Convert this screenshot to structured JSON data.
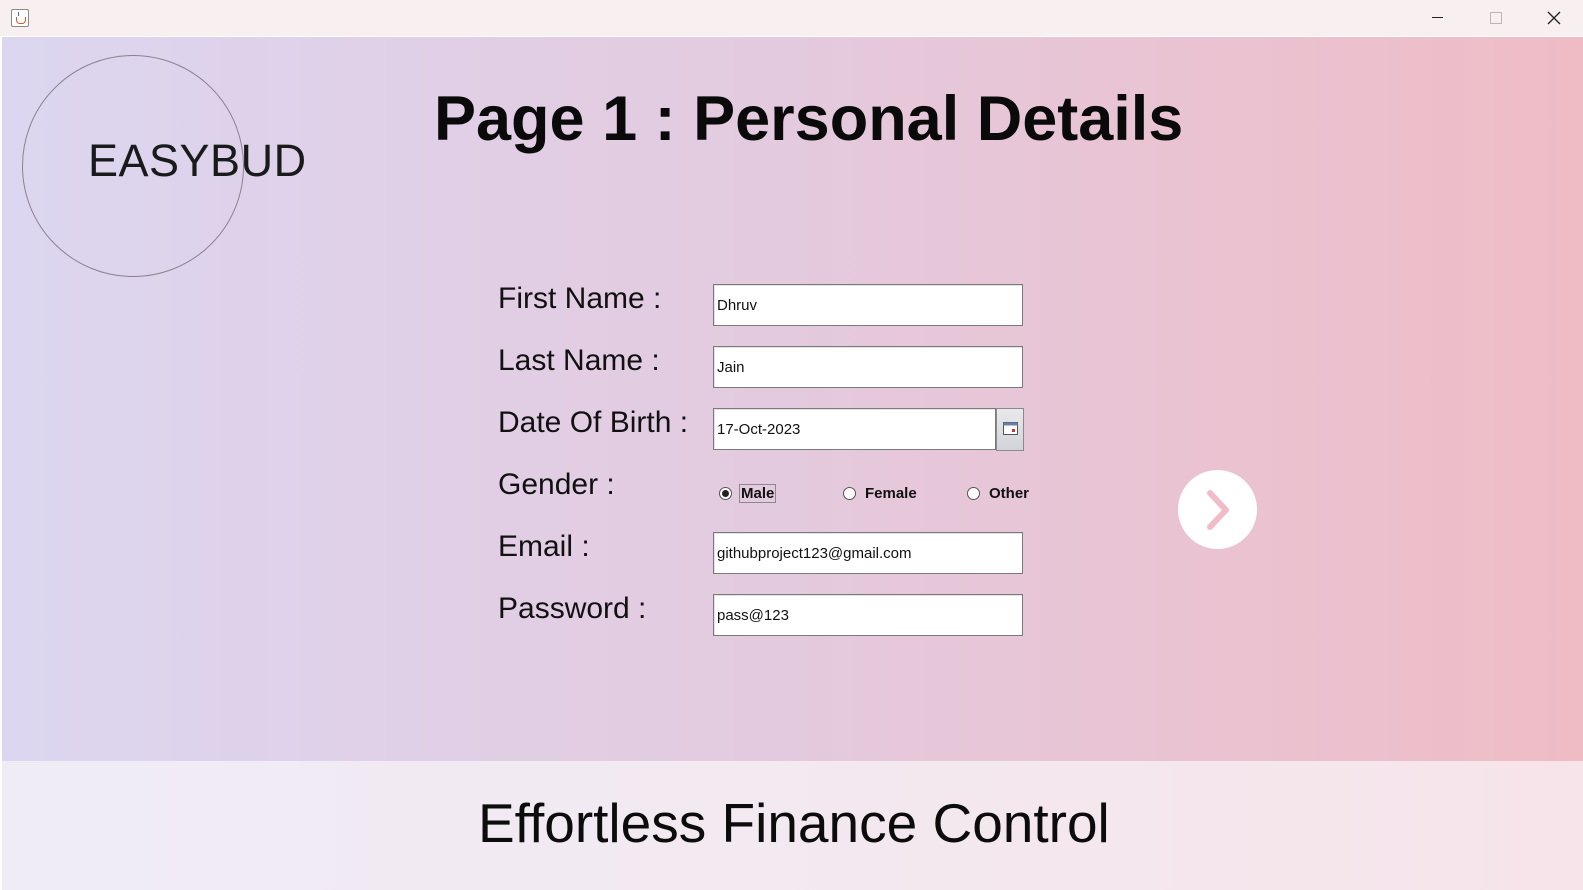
{
  "window": {
    "app_icon": "java-cup-icon",
    "controls": [
      "minimize-icon",
      "maximize-icon",
      "close-icon"
    ]
  },
  "logo": {
    "text": "EASYBUD"
  },
  "page_title": "Page 1 : Personal Details",
  "form": {
    "first_name": {
      "label": "First Name :",
      "value": "Dhruv"
    },
    "last_name": {
      "label": "Last Name :",
      "value": "Jain"
    },
    "dob": {
      "label": "Date Of Birth :",
      "value": "17-Oct-2023",
      "picker_icon": "calendar-icon"
    },
    "gender": {
      "label": "Gender :",
      "options": [
        "Male",
        "Female",
        "Other"
      ],
      "selected": "Male"
    },
    "email": {
      "label": "Email :",
      "value": "githubproject123@gmail.com"
    },
    "password": {
      "label": "Password :",
      "value": "pass@123"
    }
  },
  "next_button": {
    "icon": "chevron-right-icon",
    "color": "#f0bcc8"
  },
  "footer": {
    "tagline": "Effortless Finance Control"
  },
  "colors": {
    "gradient_left": "#dcd6f0",
    "gradient_right": "#efbcc6",
    "titlebar": "#f8f0f0"
  }
}
